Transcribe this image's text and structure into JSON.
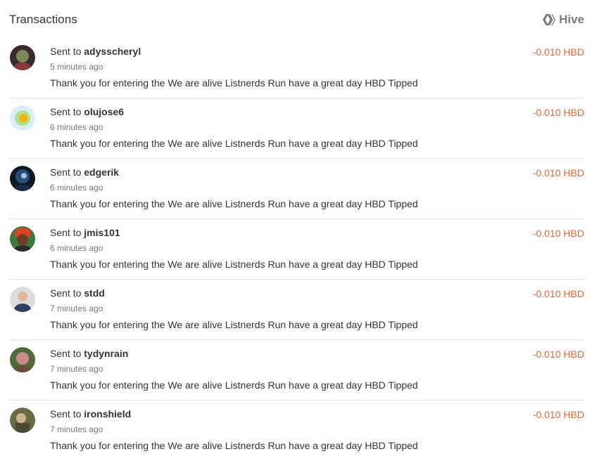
{
  "header": {
    "title": "Transactions",
    "brand": "Hive",
    "brand_icon": "hive-logo-icon"
  },
  "colors": {
    "amount": "#e0683a",
    "divider": "#e3e3e3"
  },
  "transactions": [
    {
      "prefix": "Sent to",
      "user": "adysscheryl",
      "time": "5 minutes ago",
      "memo": "Thank you for entering the We are alive Listnerds Run have a great day HBD Tipped",
      "amount": "-0.010 HBD"
    },
    {
      "prefix": "Sent to",
      "user": "olujose6",
      "time": "6 minutes ago",
      "memo": "Thank you for entering the We are alive Listnerds Run have a great day HBD Tipped",
      "amount": "-0.010 HBD"
    },
    {
      "prefix": "Sent to",
      "user": "edgerik",
      "time": "6 minutes ago",
      "memo": "Thank you for entering the We are alive Listnerds Run have a great day HBD Tipped",
      "amount": "-0.010 HBD"
    },
    {
      "prefix": "Sent to",
      "user": "jmis101",
      "time": "6 minutes ago",
      "memo": "Thank you for entering the We are alive Listnerds Run have a great day HBD Tipped",
      "amount": "-0.010 HBD"
    },
    {
      "prefix": "Sent to",
      "user": "stdd",
      "time": "7 minutes ago",
      "memo": "Thank you for entering the We are alive Listnerds Run have a great day HBD Tipped",
      "amount": "-0.010 HBD"
    },
    {
      "prefix": "Sent to",
      "user": "tydynrain",
      "time": "7 minutes ago",
      "memo": "Thank you for entering the We are alive Listnerds Run have a great day HBD Tipped",
      "amount": "-0.010 HBD"
    },
    {
      "prefix": "Sent to",
      "user": "ironshield",
      "time": "7 minutes ago",
      "memo": "Thank you for entering the We are alive Listnerds Run have a great day HBD Tipped",
      "amount": "-0.010 HBD"
    }
  ]
}
